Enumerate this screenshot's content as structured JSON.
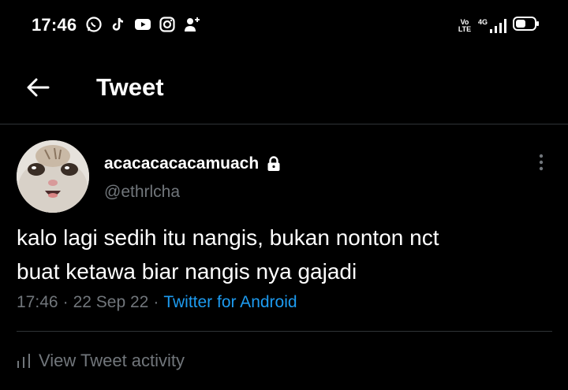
{
  "status_bar": {
    "time": "17:46",
    "left_icons": [
      "whatsapp-icon",
      "tiktok-icon",
      "youtube-icon",
      "instagram-icon",
      "add-user-icon"
    ],
    "right_icons": [
      "volte-icon",
      "signal-4g-icon",
      "battery-icon"
    ],
    "volte_text": "Vo LTE",
    "network_text": "4G"
  },
  "header": {
    "title": "Tweet",
    "back_icon": "arrow-left-icon"
  },
  "tweet": {
    "display_name": "acacacacacamuach",
    "protected_icon": "lock-icon",
    "handle": "@ethrlcha",
    "text_line1": "kalo lagi sedih itu nangis, bukan nonton nct",
    "text_line2": "buat ketawa biar nangis nya gajadi",
    "time": "17:46",
    "separator": "·",
    "date": "22 Sep 22",
    "source": "Twitter for Android"
  },
  "activity": {
    "icon": "bar-chart-icon",
    "label": "View Tweet activity"
  },
  "colors": {
    "background": "#000000",
    "text_primary": "#e7e9ea",
    "text_secondary": "#71767b",
    "link": "#1d9bf0",
    "divider": "#2f3336"
  }
}
